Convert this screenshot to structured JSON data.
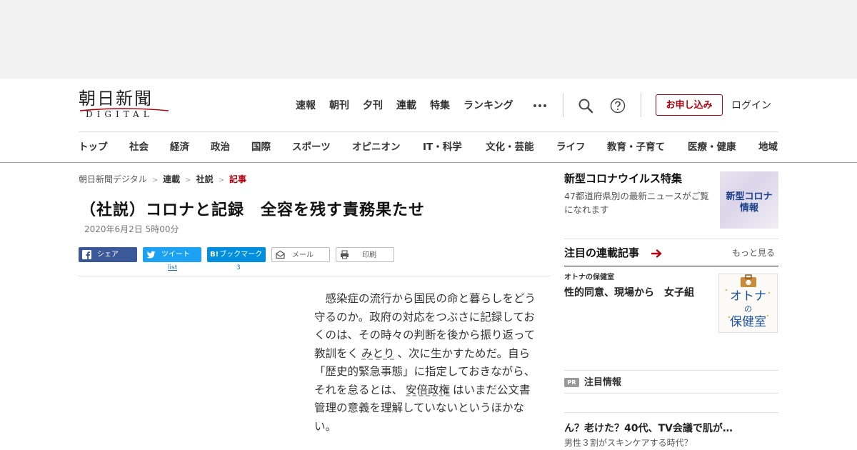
{
  "logo": {
    "main": "朝日新聞",
    "sub": "DIGITAL"
  },
  "topnav": [
    "速報",
    "朝刊",
    "夕刊",
    "連載",
    "特集",
    "ランキング"
  ],
  "header": {
    "apply_label": "お申し込み",
    "login_label": "ログイン"
  },
  "catnav": [
    "トップ",
    "社会",
    "経済",
    "政治",
    "国際",
    "スポーツ",
    "オピニオン",
    "IT・科学",
    "文化・芸能",
    "ライフ",
    "教育・子育て",
    "医療・健康",
    "地域"
  ],
  "breadcrumb": [
    "朝日新聞デジタル",
    "連載",
    "社説",
    "記事"
  ],
  "article": {
    "title": "（社説）コロナと記録　全容を残す責務果たせ",
    "date": "2020年6月2日 5時00分",
    "body_part1": "感染症の流行から国民の命と暮らしをどう守るのか。政府の対応をつぶさに記録しておくのは、その時々の判断を後から振り返って教訓をく",
    "kw1": "みとり",
    "body_part2": "、次に生かすためだ。自ら「歴史的緊急事態」に指定しておきながら、それを怠るとは、",
    "kw2": "安倍政権",
    "body_part3": "はいまだ公文書管理の意義を理解していないというほかない。"
  },
  "share": {
    "facebook": "シェア",
    "twitter": "ツイート",
    "twitter_count": "list",
    "hatena": "ブックマーク",
    "hatena_badge": "B!",
    "hatena_count": "3",
    "mail": "メール",
    "print": "印刷"
  },
  "sidebar": {
    "corona": {
      "title": "新型コロナウイルス特集",
      "desc": "47都道府県別の最新ニュースがご覧になれます",
      "thumb_line1": "新型コロナ",
      "thumb_line2": "情報"
    },
    "series": {
      "heading": "注目の連載記事",
      "more": "もっと見る",
      "sub": "オトナの保健室",
      "item": "性的同意、現場から　女子組",
      "thumb_line1": "オトナ",
      "thumb_line2": "の",
      "thumb_line3": "保健室"
    },
    "pr": {
      "badge": "PR",
      "title": "注目情報",
      "ad_title": "ん？老けた？40代、TV会議で肌が…",
      "ad_sub": "男性３割がスキンケアする時代？"
    }
  },
  "colors": {
    "brand_red": "#b0000e",
    "facebook": "#3b5998",
    "twitter": "#1da1f2",
    "hatena": "#008fde"
  }
}
